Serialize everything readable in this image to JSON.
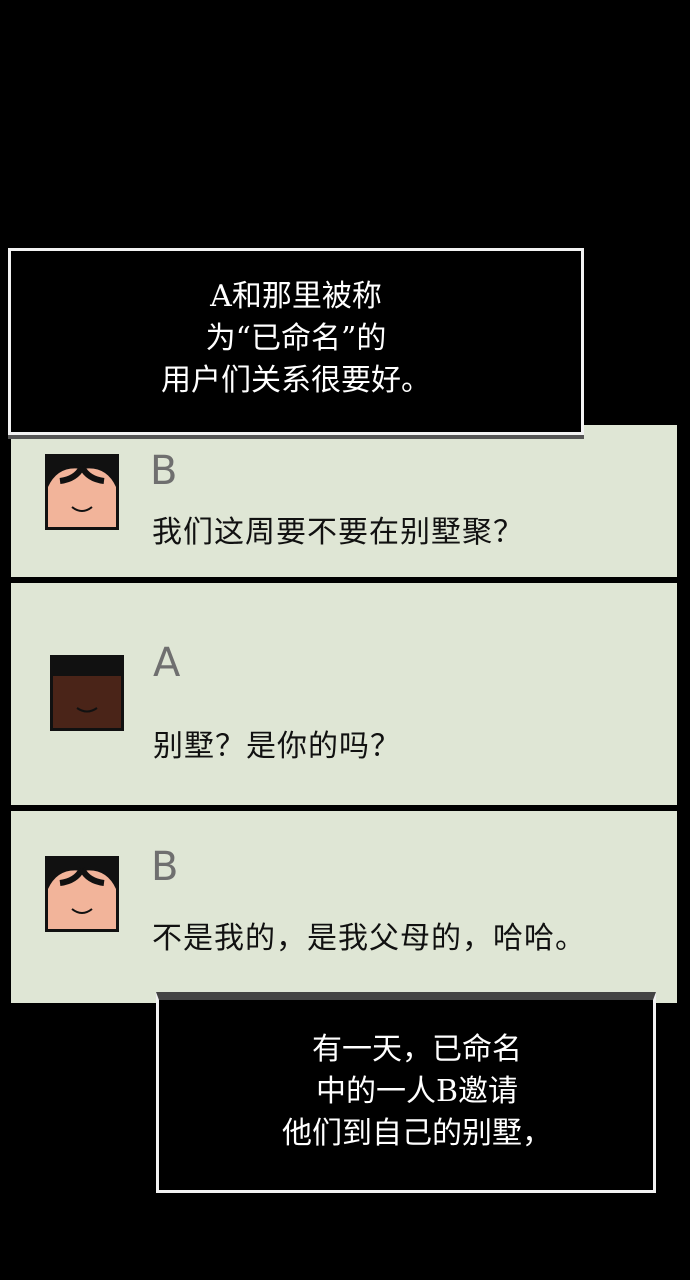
{
  "captions": {
    "top": [
      "A和那里被称",
      "为“已命名”的",
      "用户们关系很要好。"
    ],
    "bottom": [
      "有一天，已命名",
      "中的一人B邀请",
      "他们到自己的别墅，"
    ]
  },
  "chat": [
    {
      "name": "B",
      "avatar": "light-skin-face-icon",
      "message": "我们这周要不要在别墅聚？"
    },
    {
      "name": "A",
      "avatar": "dark-skin-face-icon",
      "message": "别墅？是你的吗？"
    },
    {
      "name": "B",
      "avatar": "light-skin-face-icon",
      "message": "不是我的，是我父母的，哈哈。"
    }
  ],
  "colors": {
    "background": "#000000",
    "panel": "#dfe6d5",
    "name_text": "#6f6f6f",
    "light_skin": "#f2b49a",
    "dark_skin": "#4a2418"
  }
}
